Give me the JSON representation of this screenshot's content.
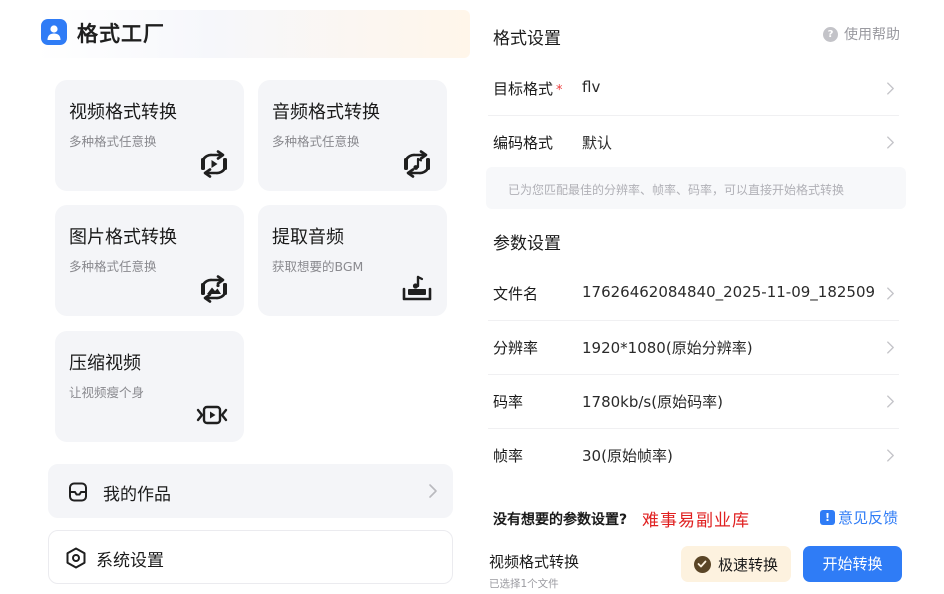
{
  "app": {
    "title": "格式工厂",
    "logo_icon": "user-logo-icon",
    "accent": "#2f7cf6"
  },
  "tools": [
    {
      "title": "视频格式转换",
      "subtitle": "多种格式任意换",
      "icon": "video-convert-icon"
    },
    {
      "title": "音频格式转换",
      "subtitle": "多种格式任意换",
      "icon": "audio-convert-icon"
    },
    {
      "title": "图片格式转换",
      "subtitle": "多种格式任意换",
      "icon": "image-convert-icon"
    },
    {
      "title": "提取音频",
      "subtitle": "获取想要的BGM",
      "icon": "extract-audio-icon"
    },
    {
      "title": "压缩视频",
      "subtitle": "让视频瘦个身",
      "icon": "compress-video-icon"
    }
  ],
  "nav": {
    "my_works": "我的作品",
    "settings": "系统设置"
  },
  "format_settings": {
    "title": "格式设置",
    "help": "使用帮助",
    "target_label": "目标格式",
    "required_mark": "*",
    "target_value": "flv",
    "codec_label": "编码格式",
    "codec_value": "默认",
    "hint": "已为您匹配最佳的分辨率、帧率、码率，可以直接开始格式转换"
  },
  "params": {
    "title": "参数设置",
    "rows": [
      {
        "label": "文件名",
        "value": "17626462084840_2025-11-09_182509"
      },
      {
        "label": "分辨率",
        "value": "1920*1080(原始分辨率)"
      },
      {
        "label": "码率",
        "value": "1780kb/s(原始码率)"
      },
      {
        "label": "帧率",
        "value": "30(原始帧率)"
      }
    ]
  },
  "footer": {
    "not_found": "没有想要的参数设置?",
    "watermark": "难事易副业库",
    "feedback": "意见反馈",
    "feedback_icon_glyph": "!",
    "task_title": "视频格式转换",
    "task_sub": "已选择1个文件",
    "fast_label": "极速转换",
    "start_label": "开始转换"
  }
}
